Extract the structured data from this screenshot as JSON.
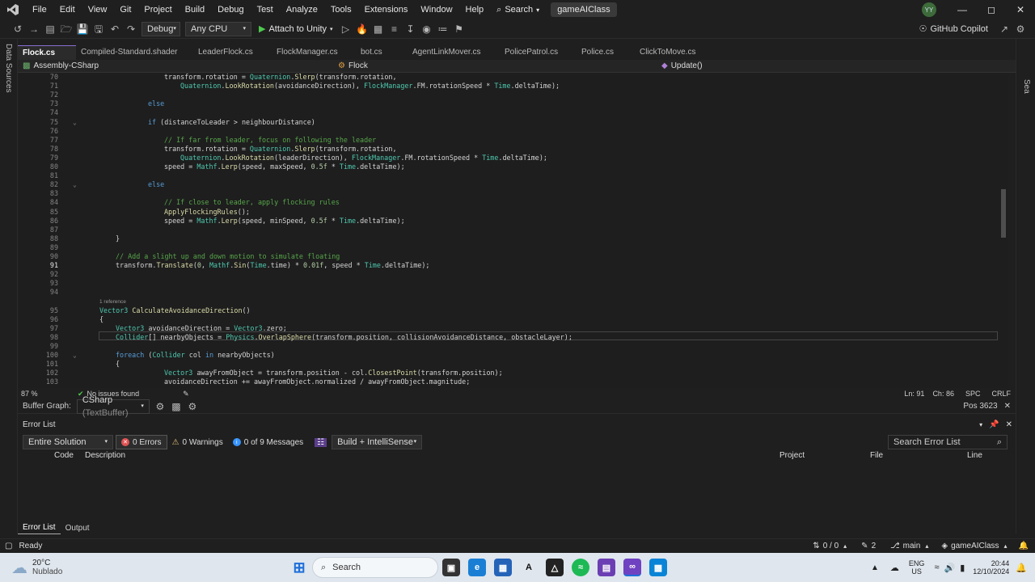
{
  "menubar": {
    "items": [
      "File",
      "Edit",
      "View",
      "Git",
      "Project",
      "Build",
      "Debug",
      "Test",
      "Analyze",
      "Tools",
      "Extensions",
      "Window",
      "Help"
    ],
    "search_label": "Search",
    "solution_name": "gameAIClass",
    "avatar_initials": "YY"
  },
  "toolbar": {
    "config": "Debug",
    "platform": "Any CPU",
    "attach_label": "Attach to Unity",
    "copilot_label": "GitHub Copilot"
  },
  "side_strip": {
    "left_label": "Data Sources",
    "right_label": "Sea"
  },
  "tabs": [
    {
      "label": "Flock.cs",
      "active": true
    },
    {
      "label": "Compiled-Standard.shader",
      "active": false
    },
    {
      "label": "LeaderFlock.cs",
      "active": false
    },
    {
      "label": "FlockManager.cs",
      "active": false
    },
    {
      "label": "bot.cs",
      "active": false
    },
    {
      "label": "AgentLinkMover.cs",
      "active": false
    },
    {
      "label": "PolicePatrol.cs",
      "active": false
    },
    {
      "label": "Police.cs",
      "active": false
    },
    {
      "label": "ClickToMove.cs",
      "active": false
    }
  ],
  "navbar": {
    "project": "Assembly-CSharp",
    "class": "Flock",
    "member": "Update()"
  },
  "code_lines": [
    {
      "n": "70",
      "indent": 8,
      "text": "transform.rotation = Quaternion.Slerp(transform.rotation,"
    },
    {
      "n": "71",
      "indent": 12,
      "text": "Quaternion.LookRotation(avoidanceDirection), FlockManager.FM.rotationSpeed * Time.deltaTime);"
    },
    {
      "n": "72",
      "indent": 0,
      "text": ""
    },
    {
      "n": "73",
      "indent": 4,
      "text": "else"
    },
    {
      "n": "74",
      "indent": 0,
      "text": ""
    },
    {
      "n": "75",
      "indent": 4,
      "text": "if (distanceToLeader > neighbourDistance)"
    },
    {
      "n": "76",
      "indent": 0,
      "text": ""
    },
    {
      "n": "77",
      "indent": 8,
      "text": "// If far from leader, focus on following the leader"
    },
    {
      "n": "78",
      "indent": 8,
      "text": "transform.rotation = Quaternion.Slerp(transform.rotation,"
    },
    {
      "n": "79",
      "indent": 12,
      "text": "Quaternion.LookRotation(leaderDirection), FlockManager.FM.rotationSpeed * Time.deltaTime);"
    },
    {
      "n": "80",
      "indent": 8,
      "text": "speed = Mathf.Lerp(speed, maxSpeed, 0.5f * Time.deltaTime);"
    },
    {
      "n": "81",
      "indent": 0,
      "text": ""
    },
    {
      "n": "82",
      "indent": 4,
      "text": "else"
    },
    {
      "n": "83",
      "indent": 0,
      "text": ""
    },
    {
      "n": "84",
      "indent": 8,
      "text": "// If close to leader, apply flocking rules"
    },
    {
      "n": "85",
      "indent": 8,
      "text": "ApplyFlockingRules();"
    },
    {
      "n": "86",
      "indent": 8,
      "text": "speed = Mathf.Lerp(speed, minSpeed, 0.5f * Time.deltaTime);"
    },
    {
      "n": "87",
      "indent": 0,
      "text": ""
    },
    {
      "n": "88",
      "indent": 0,
      "text": "}"
    },
    {
      "n": "89",
      "indent": 0,
      "text": ""
    },
    {
      "n": "90",
      "indent": 0,
      "text": "// Add a slight up and down motion to simulate floating"
    },
    {
      "n": "91",
      "indent": 0,
      "text": "transform.Translate(0, Mathf.Sin(Time.time) * 0.01f, speed * Time.deltaTime);"
    },
    {
      "n": "92",
      "indent": 0,
      "text": ""
    },
    {
      "n": "93",
      "indent": 0,
      "text": ""
    },
    {
      "n": "94",
      "indent": 0,
      "text": ""
    },
    {
      "n": "",
      "indent": 0,
      "text": "1 reference"
    },
    {
      "n": "95",
      "indent": 0,
      "text": "Vector3 CalculateAvoidanceDirection()"
    },
    {
      "n": "96",
      "indent": 0,
      "text": "{"
    },
    {
      "n": "97",
      "indent": 4,
      "text": "Vector3 avoidanceDirection = Vector3.zero;"
    },
    {
      "n": "98",
      "indent": 4,
      "text": "Collider[] nearbyObjects = Physics.OverlapSphere(transform.position, collisionAvoidanceDistance, obstacleLayer);"
    },
    {
      "n": "99",
      "indent": 0,
      "text": ""
    },
    {
      "n": "100",
      "indent": 4,
      "text": "foreach (Collider col in nearbyObjects)"
    },
    {
      "n": "101",
      "indent": 4,
      "text": "{"
    },
    {
      "n": "102",
      "indent": 8,
      "text": "Vector3 awayFromObject = transform.position - col.ClosestPoint(transform.position);"
    },
    {
      "n": "103",
      "indent": 8,
      "text": "avoidanceDirection += awayFromObject.normalized / awayFromObject.magnitude;"
    }
  ],
  "editor_status": {
    "zoom": "87 %",
    "issues": "No issues found",
    "line": "Ln: 91",
    "col": "Ch: 86",
    "spc": "SPC",
    "eol": "CRLF"
  },
  "buffer_bar": {
    "label": "Buffer Graph:",
    "value": "CSharp",
    "hint": "(TextBuffer)",
    "pos": "Pos 3623"
  },
  "error_list": {
    "title": "Error List",
    "scope": "Entire Solution",
    "errors": "0 Errors",
    "warnings": "0 Warnings",
    "messages": "0 of 9 Messages",
    "build_filter": "Build + IntelliSense",
    "search_placeholder": "Search Error List",
    "columns": [
      "Code",
      "Description",
      "Project",
      "File",
      "Line"
    ],
    "bottom_tabs": [
      "Error List",
      "Output"
    ]
  },
  "statusbar": {
    "ready": "Ready",
    "lines": "0 / 0",
    "edits": "2",
    "branch": "main",
    "solution": "gameAIClass"
  },
  "taskbar": {
    "weather_temp": "20°C",
    "weather_desc": "Nublado",
    "search_label": "Search",
    "lang_top": "ENG",
    "lang_bottom": "US",
    "time": "20:44",
    "date": "12/10/2024"
  }
}
